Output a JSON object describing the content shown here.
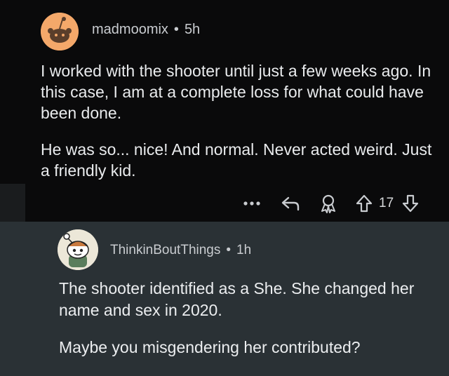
{
  "top_comment": {
    "author": "madmoomix",
    "separator": "•",
    "age": "5h",
    "paragraphs": [
      "I worked with the shooter until just a few weeks ago. In this case, I am at a complete loss for what could have been done.",
      "He was so... nice! And normal. Never acted weird. Just a friendly kid."
    ],
    "actions": {
      "more_icon": "more-dots-icon",
      "reply_icon": "reply-arrow-icon",
      "award_icon": "award-icon",
      "upvote_icon": "upvote-arrow-icon",
      "vote_count": "17",
      "downvote_icon": "downvote-arrow-icon"
    },
    "avatar_icon": "snoo-avatar-icon",
    "avatar_color": "#f4a86a"
  },
  "reply_comment": {
    "author": "ThinkinBoutThings",
    "separator": "•",
    "age": "1h",
    "paragraphs": [
      "The shooter identified as a She. She changed her name and sex in 2020.",
      "Maybe you misgendering her contributed?"
    ],
    "avatar_icon": "snoo-avatar-icon"
  },
  "colors": {
    "top_background": "#0a0a0b",
    "reply_background": "#2a3135",
    "meta_text": "#c9ccd0",
    "body_text": "#e9ebed"
  }
}
